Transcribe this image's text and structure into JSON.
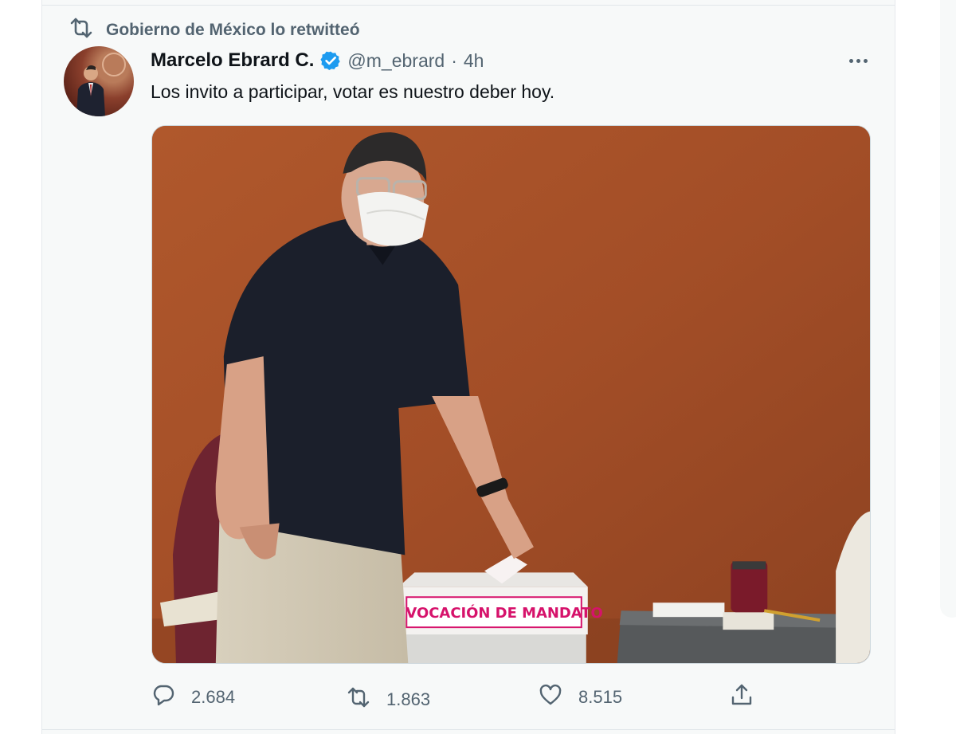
{
  "retweet_context": {
    "label": "Gobierno de México lo retwitteó",
    "icon": "retweet-icon"
  },
  "tweet": {
    "display_name": "Marcelo Ebrard C.",
    "verified": true,
    "verified_color": "#1d9bf0",
    "handle": "@m_ebrard",
    "separator": "·",
    "time": "4h",
    "text": "Los invito a participar, votar es nuestro deber hoy.",
    "media": {
      "ballot_box_label": "REVOCACIÓN DE MANDATO"
    },
    "actions": {
      "replies": "2.684",
      "retweets": "1.863",
      "likes": "8.515"
    }
  },
  "colors": {
    "muted_text": "#536471",
    "wall": "#a5512a",
    "label_pink": "#d6126b"
  }
}
